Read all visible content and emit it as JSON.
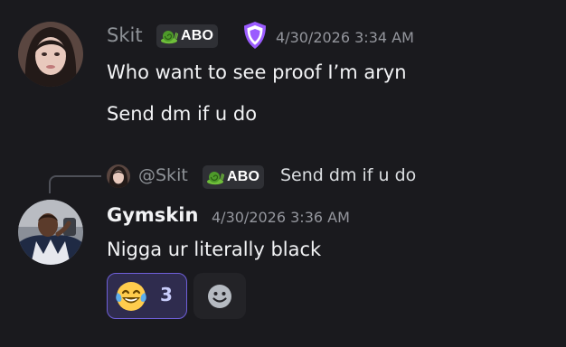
{
  "messages": [
    {
      "author": "Skit",
      "author_color": "#8e9297",
      "tag": "ABO",
      "timestamp": "4/30/2026 3:34 AM",
      "lines": [
        "Who want to see proof I’m aryn",
        "Send dm if u do"
      ]
    },
    {
      "author": "Gymskin",
      "author_color": "#f2f3f5",
      "timestamp": "4/30/2026 3:36 AM",
      "lines": [
        "Nigga ur literally black"
      ],
      "reply": {
        "author": "@Skit",
        "tag": "ABO",
        "text": "Send dm if u do"
      },
      "reactions": [
        {
          "emoji": "😂",
          "count": "3",
          "selected": true
        },
        {
          "emoji": "add-reaction",
          "count": "",
          "selected": false
        }
      ]
    }
  ],
  "colors": {
    "background": "#1a1a1e",
    "badge_purple": "#9b5cff",
    "reaction_selected_bg": "#2f2c4e",
    "reaction_selected_border": "#6e5fd8"
  }
}
